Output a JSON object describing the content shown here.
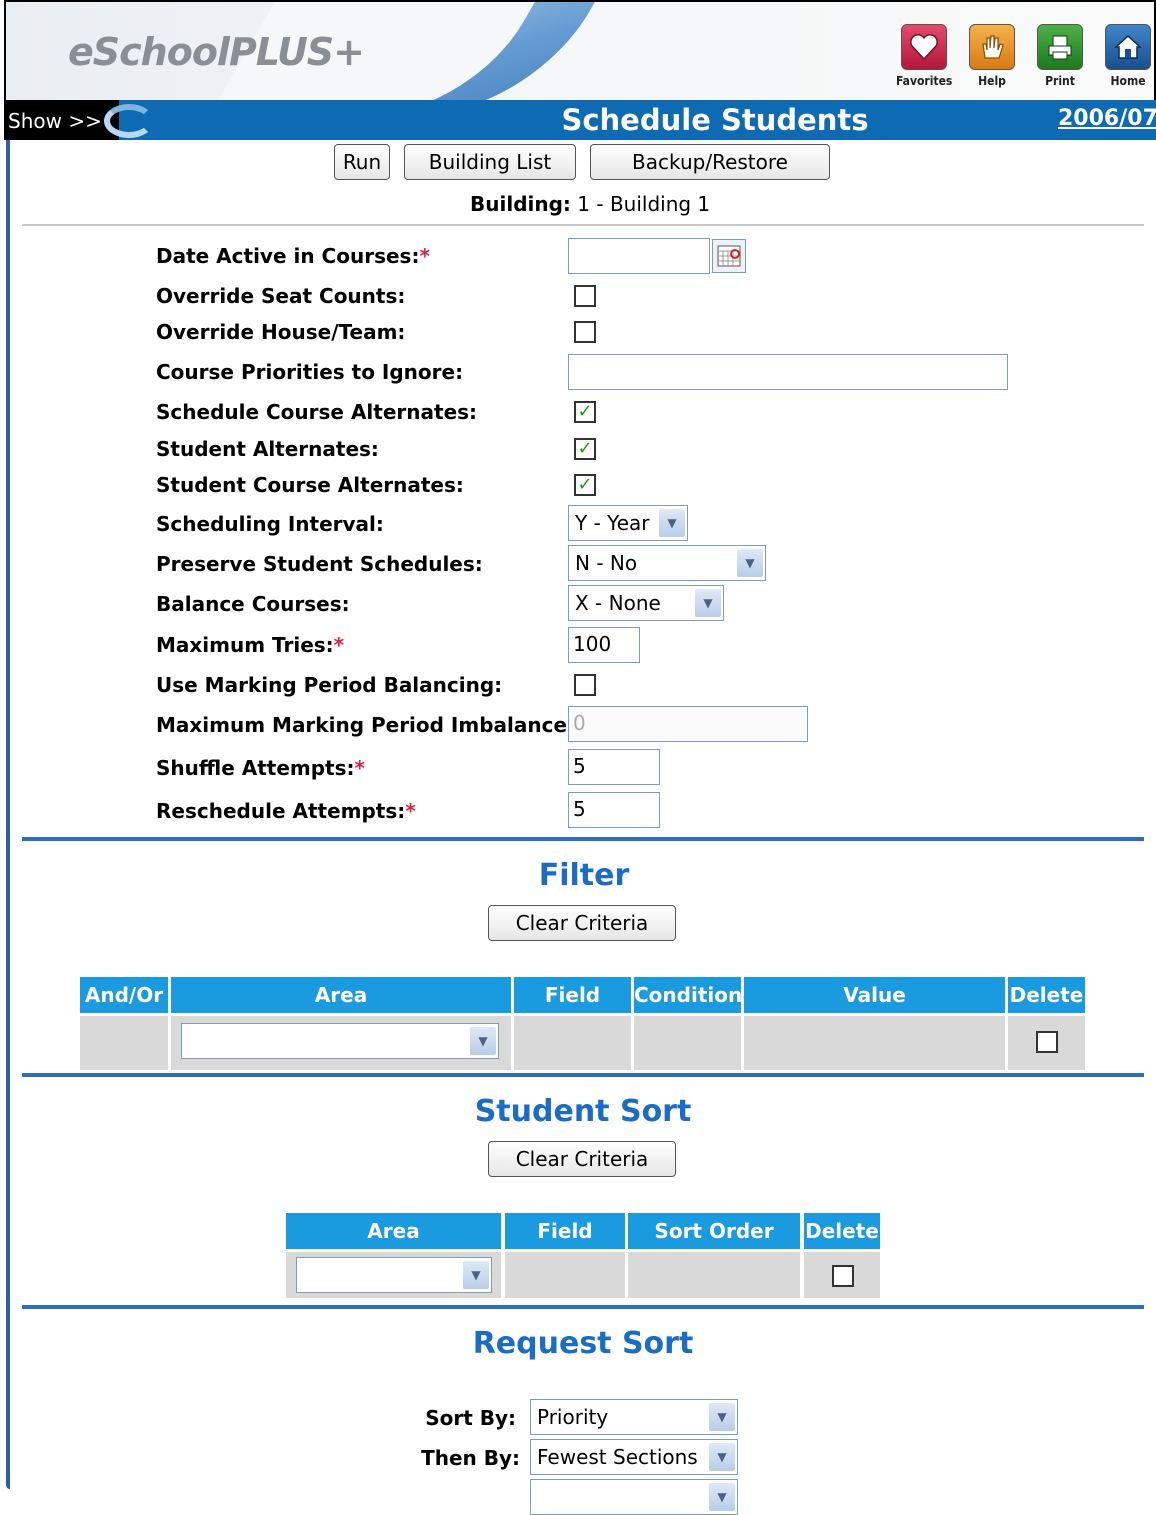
{
  "header": {
    "logo": "eSchoolPLUS+",
    "toolbar": [
      {
        "label": "Favorites",
        "icon": "heart-icon"
      },
      {
        "label": "Help",
        "icon": "hand-icon"
      },
      {
        "label": "Print",
        "icon": "printer-icon"
      },
      {
        "label": "Home",
        "icon": "home-icon"
      }
    ],
    "colors": {
      "title_bar": "#0d6ab3",
      "section_title": "#1a6cc7",
      "table_header": "#1a9be0",
      "required": "#e0203b"
    }
  },
  "titlebar": {
    "show_label": "Show >>",
    "title": "Schedule Students",
    "year": "2006/07"
  },
  "actions": {
    "run": "Run",
    "building_list": "Building List",
    "backup_restore": "Backup/Restore"
  },
  "building": {
    "label": "Building:",
    "value": "1 - Building 1"
  },
  "form": {
    "date_active": {
      "label": "Date Active in Courses:",
      "required": "*",
      "value": ""
    },
    "override_seat": {
      "label": "Override Seat Counts:",
      "checked": false
    },
    "override_house": {
      "label": "Override House/Team:",
      "checked": false
    },
    "course_priorities": {
      "label": "Course Priorities to Ignore:",
      "value": ""
    },
    "schedule_course_alt": {
      "label": "Schedule Course Alternates:",
      "checked": true
    },
    "student_alt": {
      "label": "Student Alternates:",
      "checked": true
    },
    "student_course_alt": {
      "label": "Student Course Alternates:",
      "checked": true
    },
    "scheduling_interval": {
      "label": "Scheduling Interval:",
      "value": "Y - Year"
    },
    "preserve_schedules": {
      "label": "Preserve Student Schedules:",
      "value": "N - No"
    },
    "balance_courses": {
      "label": "Balance Courses:",
      "value": "X - None"
    },
    "max_tries": {
      "label": "Maximum Tries:",
      "required": "*",
      "value": "100"
    },
    "marking_period_balancing": {
      "label": "Use Marking Period Balancing:",
      "checked": false
    },
    "max_mp_imbalance": {
      "label": "Maximum Marking Period Imbalance:",
      "required": "*",
      "value": "0"
    },
    "shuffle_attempts": {
      "label": "Shuffle Attempts:",
      "required": "*",
      "value": "5"
    },
    "reschedule_attempts": {
      "label": "Reschedule Attempts:",
      "required": "*",
      "value": "5"
    }
  },
  "filter": {
    "title": "Filter",
    "clear": "Clear Criteria",
    "columns": [
      "And/Or",
      "Area",
      "Field Name",
      "Condition",
      "Value",
      "Delete"
    ],
    "row": {
      "area": ""
    }
  },
  "student_sort": {
    "title": "Student Sort",
    "clear": "Clear Criteria",
    "columns": [
      "Area",
      "Field Name",
      "Sort Order",
      "Delete"
    ],
    "row": {
      "area": ""
    }
  },
  "request_sort": {
    "title": "Request Sort",
    "sort_by": {
      "label": "Sort By:",
      "value": "Priority"
    },
    "then_by": {
      "label": "Then By:",
      "value": "Fewest Sections"
    }
  }
}
